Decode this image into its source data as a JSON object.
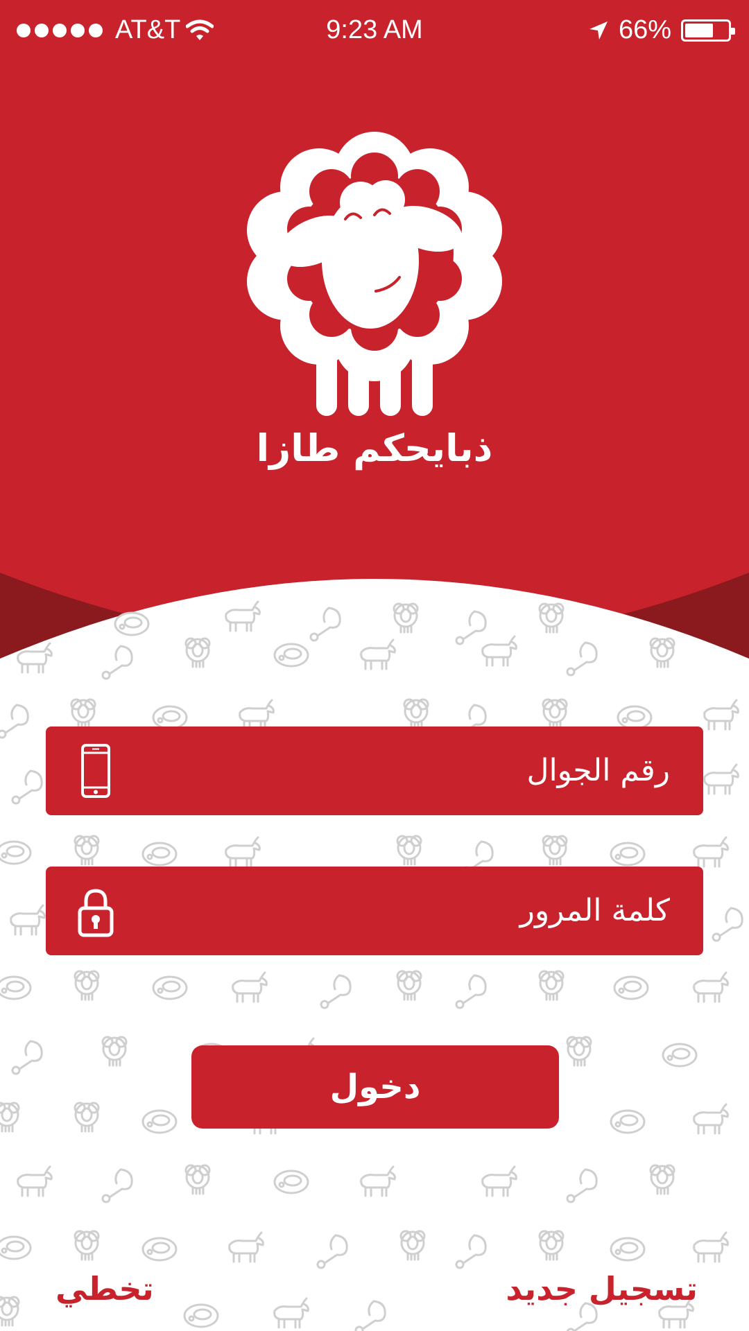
{
  "status_bar": {
    "carrier": "AT&T",
    "time": "9:23 AM",
    "battery": "66%",
    "battery_level": 0.66,
    "icons": [
      "signal-dots",
      "wifi-icon",
      "location-arrow-icon",
      "battery-icon"
    ]
  },
  "brand": {
    "name": "ذبايحكم طازا",
    "logo": "sheep-logo"
  },
  "form": {
    "phone_label": "رقم الجوال",
    "phone_icon": "mobile-phone-icon",
    "password_label": "كلمة المرور",
    "password_icon": "padlock-icon"
  },
  "actions": {
    "login": "دخول",
    "skip": "تخطي",
    "register": "تسجيل جديد"
  },
  "colors": {
    "primary": "#c8232c",
    "primary_dark": "#8b1a1f",
    "pattern": "#c9c9c9",
    "background": "#ffffff"
  }
}
